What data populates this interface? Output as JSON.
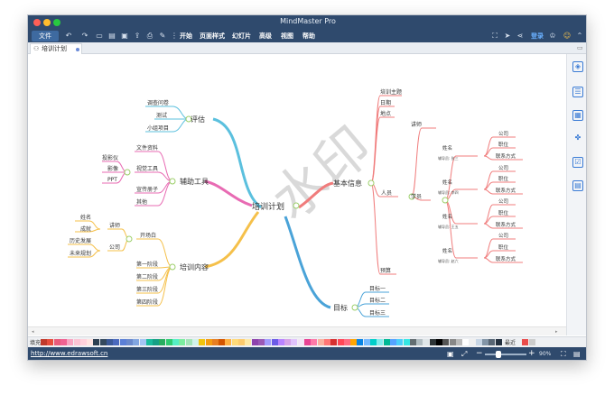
{
  "window": {
    "title": "MindMaster Pro"
  },
  "toolbar": {
    "file_label": "文件",
    "menus": [
      "开始",
      "页面样式",
      "幻灯片",
      "高级",
      "视图",
      "帮助"
    ],
    "login_label": "登录"
  },
  "tab": {
    "label": "培训计划"
  },
  "status": {
    "url": "http://www.edrawsoft.cn",
    "zoom": "90%"
  },
  "palette": {
    "fill_label": "填充",
    "recent_label": "最近"
  },
  "watermark": "水印",
  "mindmap": {
    "center": "培训计划",
    "eval": {
      "label": "评估",
      "items": [
        "调查问卷",
        "测试",
        "小组项目"
      ]
    },
    "tools": {
      "label": "辅助工具",
      "items": [
        "文件资料",
        "视觉工具",
        "宣传册子",
        "其他"
      ],
      "visual_sub": [
        "投影仪",
        "影像",
        "PPT"
      ]
    },
    "content": {
      "label": "培训内容",
      "opening": "开场白",
      "lecturer": "讲师",
      "lecturer_sub": [
        "姓名",
        "成就"
      ],
      "company": "公司",
      "company_sub": [
        "历史发展",
        "未来规划"
      ],
      "stages": [
        "第一阶段",
        "第二阶段",
        "第三阶段",
        "第四阶段"
      ]
    },
    "basic": {
      "label": "基本信息",
      "items": [
        "培训主题",
        "日期",
        "地点",
        "预算"
      ],
      "people": "人员",
      "trainer": "讲师",
      "students": "学员",
      "student_groups": [
        {
          "name": "姓名",
          "note": "辅导员: 张三",
          "fields": [
            "公司",
            "职位",
            "联系方式"
          ]
        },
        {
          "name": "姓名",
          "note": "辅导员: 李四",
          "fields": [
            "公司",
            "职位",
            "联系方式"
          ]
        },
        {
          "name": "姓名",
          "note": "辅导员: 王五",
          "fields": [
            "公司",
            "职位",
            "联系方式"
          ]
        },
        {
          "name": "姓名",
          "note": "辅导员: 赵六",
          "fields": [
            "公司",
            "职位",
            "联系方式"
          ]
        }
      ]
    },
    "goals": {
      "label": "目标",
      "items": [
        "目标一",
        "目标二",
        "目标三"
      ]
    }
  },
  "colors": {
    "eval": "#5bc0de",
    "tools": "#e86bb3",
    "content": "#f5c04a",
    "basic": "#f07c7c",
    "goals": "#4aa3d8",
    "chrome": "#2f4a6d"
  }
}
